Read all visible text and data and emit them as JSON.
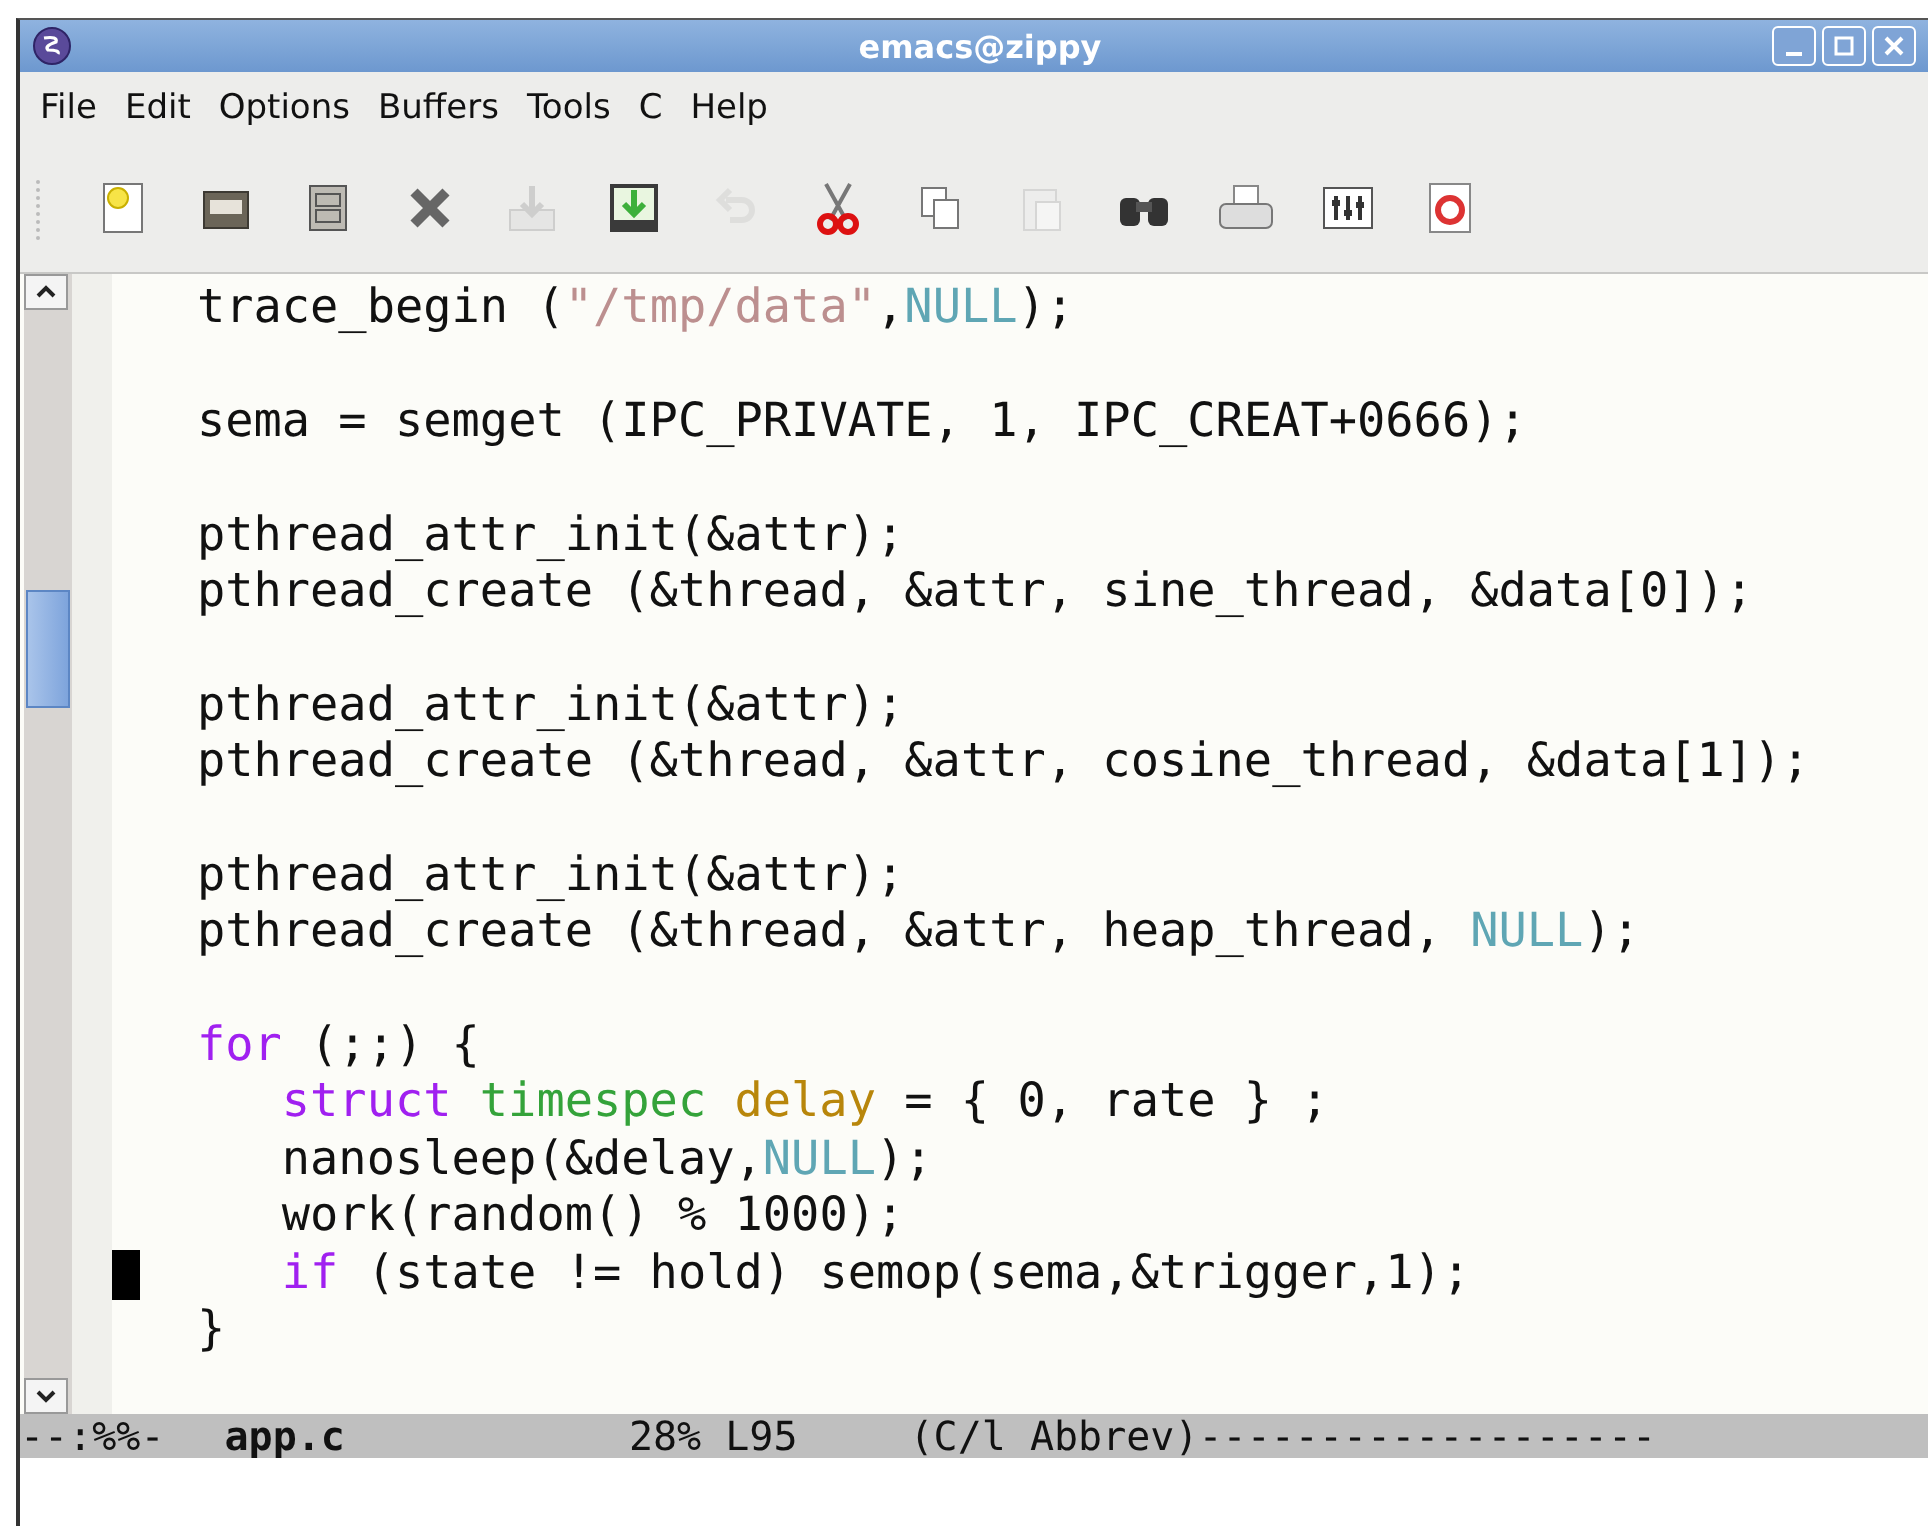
{
  "window": {
    "title": "emacs@zippy"
  },
  "menu": [
    "File",
    "Edit",
    "Options",
    "Buffers",
    "Tools",
    "C",
    "Help"
  ],
  "toolbar": [
    {
      "kind": "new",
      "disabled": false
    },
    {
      "kind": "open",
      "disabled": false
    },
    {
      "kind": "cabinet",
      "disabled": false
    },
    {
      "kind": "close",
      "disabled": false
    },
    {
      "kind": "save",
      "disabled": true
    },
    {
      "kind": "saveas",
      "disabled": false
    },
    {
      "kind": "undo",
      "disabled": true
    },
    {
      "kind": "cut",
      "disabled": false
    },
    {
      "kind": "copy",
      "disabled": false
    },
    {
      "kind": "paste",
      "disabled": true
    },
    {
      "kind": "search",
      "disabled": false
    },
    {
      "kind": "print",
      "disabled": false
    },
    {
      "kind": "prefs",
      "disabled": false
    },
    {
      "kind": "help",
      "disabled": false
    }
  ],
  "code_lines": [
    {
      "kind": "code",
      "cursor": false,
      "segments": [
        {
          "kind": "plain",
          "text": "trace_begin ("
        },
        {
          "kind": "string",
          "text": "\"/tmp/data\""
        },
        {
          "kind": "plain",
          "text": ","
        },
        {
          "kind": "constant",
          "text": "NULL"
        },
        {
          "kind": "plain",
          "text": ");"
        }
      ]
    },
    {
      "kind": "blank"
    },
    {
      "kind": "code",
      "cursor": false,
      "segments": [
        {
          "kind": "plain",
          "text": "sema = semget (IPC_PRIVATE, 1, IPC_CREAT+0666);"
        }
      ]
    },
    {
      "kind": "blank"
    },
    {
      "kind": "code",
      "cursor": false,
      "segments": [
        {
          "kind": "plain",
          "text": "pthread_attr_init(&attr);"
        }
      ]
    },
    {
      "kind": "code",
      "cursor": false,
      "segments": [
        {
          "kind": "plain",
          "text": "pthread_create (&thread, &attr, sine_thread, &data[0]);"
        }
      ]
    },
    {
      "kind": "blank"
    },
    {
      "kind": "code",
      "cursor": false,
      "segments": [
        {
          "kind": "plain",
          "text": "pthread_attr_init(&attr);"
        }
      ]
    },
    {
      "kind": "code",
      "cursor": false,
      "segments": [
        {
          "kind": "plain",
          "text": "pthread_create (&thread, &attr, cosine_thread, &data[1]);"
        }
      ]
    },
    {
      "kind": "blank"
    },
    {
      "kind": "code",
      "cursor": false,
      "segments": [
        {
          "kind": "plain",
          "text": "pthread_attr_init(&attr);"
        }
      ]
    },
    {
      "kind": "code",
      "cursor": false,
      "segments": [
        {
          "kind": "plain",
          "text": "pthread_create (&thread, &attr, heap_thread, "
        },
        {
          "kind": "constant",
          "text": "NULL"
        },
        {
          "kind": "plain",
          "text": ");"
        }
      ]
    },
    {
      "kind": "blank"
    },
    {
      "kind": "code",
      "cursor": false,
      "segments": [
        {
          "kind": "keyword",
          "text": "for"
        },
        {
          "kind": "plain",
          "text": " (;;) {"
        }
      ],
      "children": [
        {
          "kind": "code",
          "cursor": false,
          "segments": [
            {
              "kind": "keyword",
              "text": "struct"
            },
            {
              "kind": "type",
              "text": "timespec",
              "space_before": true
            },
            {
              "kind": "variable",
              "text": "delay",
              "space_before": true
            },
            {
              "kind": "plain",
              "text": " = { 0, rate } ;"
            }
          ]
        },
        {
          "kind": "code",
          "cursor": false,
          "segments": [
            {
              "kind": "plain",
              "text": "nanosleep(&delay,"
            },
            {
              "kind": "constant",
              "text": "NULL"
            },
            {
              "kind": "plain",
              "text": ");"
            }
          ]
        },
        {
          "kind": "code",
          "cursor": false,
          "segments": [
            {
              "kind": "plain",
              "text": "work(random() % 1000);"
            }
          ]
        },
        {
          "kind": "code",
          "cursor": true,
          "segments": [
            {
              "kind": "keyword",
              "text": "if"
            },
            {
              "kind": "plain",
              "text": " (state != hold) semop(sema,&trigger,1);"
            }
          ]
        }
      ]
    },
    {
      "kind": "code",
      "cursor": false,
      "segments": [
        {
          "kind": "plain",
          "text": "}"
        }
      ]
    }
  ],
  "mode_line": {
    "status": "--:%%-",
    "buffer": "app.c",
    "position": "28% L95",
    "mode": "(C/l Abbrev)-------------------"
  }
}
